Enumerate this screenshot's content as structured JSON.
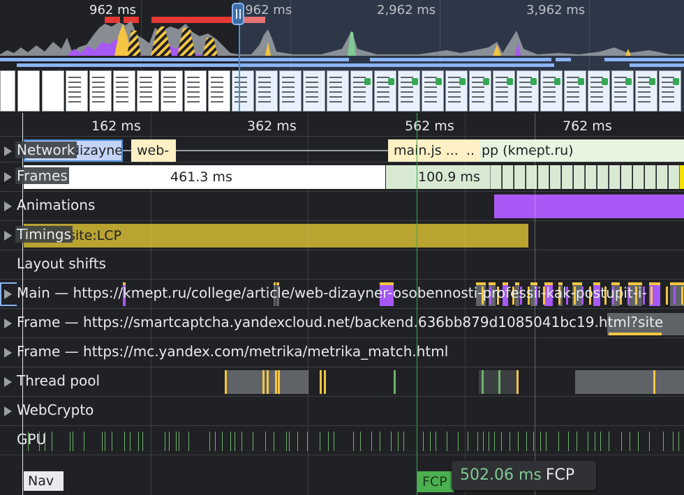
{
  "overview": {
    "ticks": [
      {
        "label": "962 ms"
      },
      {
        "label": "1,962 ms"
      },
      {
        "label": "2,962 ms"
      },
      {
        "label": "3,962 ms"
      }
    ]
  },
  "ruler": {
    "labels": [
      "162 ms",
      "362 ms",
      "562 ms",
      "762 ms"
    ]
  },
  "tracks": {
    "network": {
      "name": "Network",
      "blocks": [
        "dizayne",
        "web-",
        "main.js ...",
        "..",
        "pp (kmept.ru)"
      ]
    },
    "frames": {
      "name": "Frames",
      "durations": [
        "461.3 ms",
        "100.9 ms"
      ]
    },
    "animations": {
      "name": "Animations"
    },
    "timings": {
      "name": "Timings",
      "block": "site:LCP"
    },
    "layout_shifts": {
      "name": "Layout shifts"
    },
    "main": {
      "name": "Main — https://kmept.ru/college/article/web-dizayner-osobennosti-professii-kak-postupit-i-"
    },
    "frame1": {
      "name": "Frame — https://smartcaptcha.yandexcloud.net/backend.636bb879d1085041bc19.html?site"
    },
    "frame2": {
      "name": "Frame — https://mc.yandex.com/metrika/metrika_match.html"
    },
    "thread_pool": {
      "name": "Thread pool"
    },
    "webcrypto": {
      "name": "WebCrypto"
    },
    "gpu": {
      "name": "GPU"
    }
  },
  "markers": {
    "nav": "Nav",
    "fcp": "FCP"
  },
  "tooltip": {
    "value": "502.06 ms",
    "name": "FCP"
  },
  "colors": {
    "background": "#202124",
    "frame_good": "#d9ead3",
    "animation": "#a758f5",
    "timing": "#b9a331",
    "script": "#f4c542",
    "gpu": "#6fb36b",
    "fcp": "#34a853",
    "network_doc": "#8ab4f8",
    "network_script": "#fdf0c4",
    "network_other": "#e6f4e0"
  },
  "icons": [
    "expand-triangle-icon",
    "range-handle-icon"
  ]
}
